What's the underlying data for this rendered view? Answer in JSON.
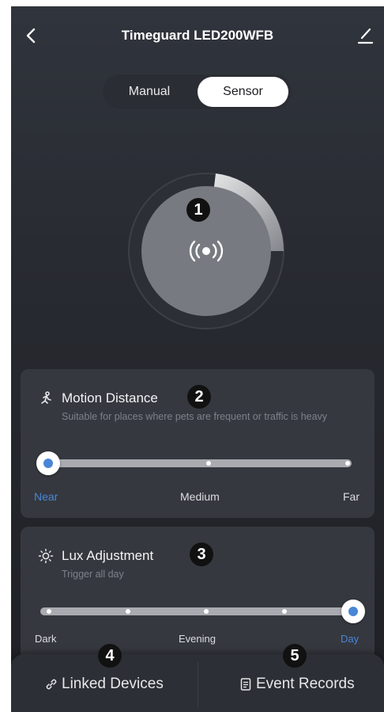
{
  "header": {
    "title": "Timeguard LED200WFB",
    "back_icon": "chevron-left-icon",
    "edit_icon": "pencil-icon"
  },
  "mode_toggle": {
    "options": [
      "Manual",
      "Sensor"
    ],
    "selected": "Sensor"
  },
  "sensor": {
    "icon": "sensor-broadcast-icon"
  },
  "annotations": [
    "1",
    "2",
    "3",
    "4",
    "5"
  ],
  "motion_distance": {
    "icon": "running-person-icon",
    "title": "Motion Distance",
    "subtitle": "Suitable for places where pets are frequent or traffic is heavy",
    "levels": [
      "Near",
      "Medium",
      "Far"
    ],
    "selected": "Near",
    "value_fraction": 0
  },
  "lux_adjustment": {
    "icon": "sun-icon",
    "title": "Lux Adjustment",
    "subtitle": "Trigger all day",
    "levels": [
      "Dark",
      "Evening",
      "Day"
    ],
    "selected": "Day",
    "value_fraction": 1
  },
  "bottom_bar": {
    "linked_devices": {
      "icon": "link-icon",
      "label": "Linked Devices"
    },
    "event_records": {
      "icon": "document-icon",
      "label": "Event Records"
    }
  },
  "colors": {
    "background": "#2a2d33",
    "card": "#35383f",
    "accent": "#4a86d6",
    "dial_core": "#777a80"
  }
}
